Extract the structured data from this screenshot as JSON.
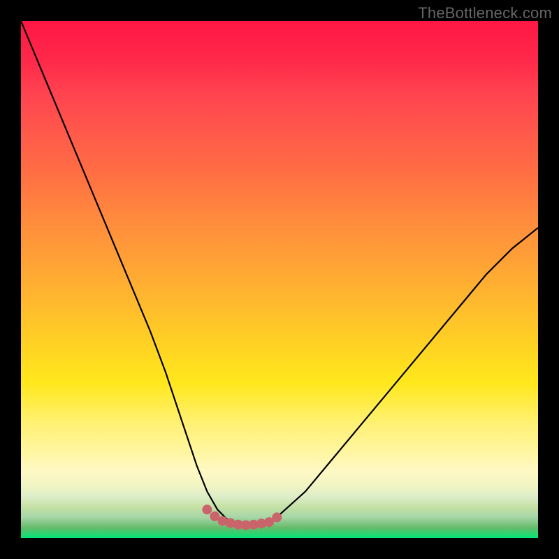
{
  "watermark": "TheBottleneck.com",
  "colors": {
    "background": "#000000",
    "curve": "#000000",
    "marker": "#c9646a",
    "gradient_top": "#ff1744",
    "gradient_bottom": "#00e676"
  },
  "chart_data": {
    "type": "line",
    "title": "",
    "xlabel": "",
    "ylabel": "",
    "xlim": [
      0,
      100
    ],
    "ylim": [
      0,
      100
    ],
    "series": [
      {
        "name": "bottleneck-curve",
        "x": [
          0,
          5,
          10,
          15,
          20,
          25,
          28,
          30,
          32,
          34,
          36,
          38,
          40,
          42,
          44,
          46,
          48,
          50,
          55,
          60,
          65,
          70,
          75,
          80,
          85,
          90,
          95,
          100
        ],
        "y": [
          100,
          88,
          76,
          64,
          52,
          40,
          32,
          26,
          20,
          14,
          9,
          5.5,
          3.5,
          2.8,
          2.5,
          2.6,
          3.0,
          4.5,
          9,
          15,
          21,
          27,
          33,
          39,
          45,
          51,
          56,
          60
        ]
      }
    ],
    "markers": {
      "name": "flat-region-markers",
      "x": [
        36,
        37.5,
        39,
        40.5,
        42,
        43.5,
        45,
        46.5,
        48,
        49.5
      ],
      "y": [
        5.5,
        4.2,
        3.3,
        2.9,
        2.6,
        2.5,
        2.6,
        2.8,
        3.1,
        4.0
      ]
    }
  }
}
